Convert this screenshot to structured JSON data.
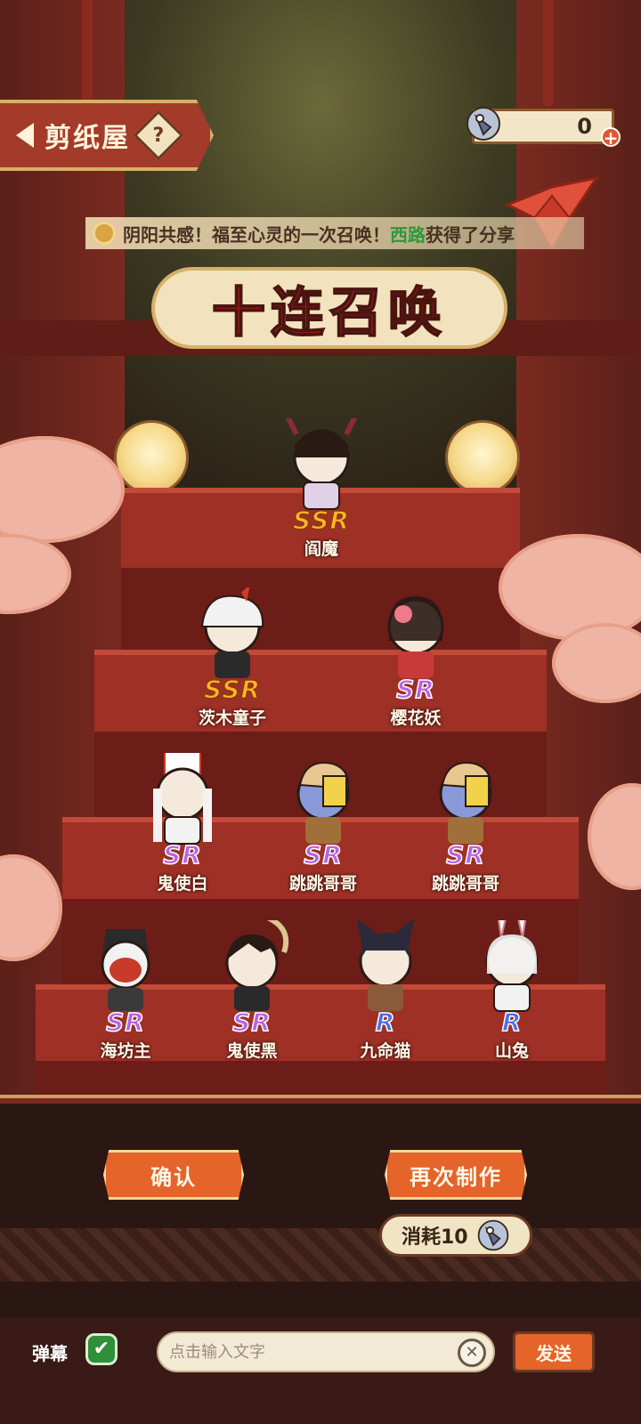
{
  "header": {
    "title": "剪纸屋",
    "help_symbol": "?",
    "currency_value": "0",
    "plus_symbol": "+"
  },
  "marquee": {
    "prefix": "阴阳共感！福至心灵的一次召唤！",
    "player": "西路",
    "suffix": "获得了分享"
  },
  "banner": {
    "title": "十连召唤"
  },
  "results": [
    {
      "rarity": "SSR",
      "name": "阎魔"
    },
    {
      "rarity": "SSR",
      "name": "茨木童子"
    },
    {
      "rarity": "SR",
      "name": "樱花妖"
    },
    {
      "rarity": "SR",
      "name": "鬼使白"
    },
    {
      "rarity": "SR",
      "name": "跳跳哥哥"
    },
    {
      "rarity": "SR",
      "name": "跳跳哥哥"
    },
    {
      "rarity": "SR",
      "name": "海坊主"
    },
    {
      "rarity": "SR",
      "name": "鬼使黑"
    },
    {
      "rarity": "R",
      "name": "九命猫"
    },
    {
      "rarity": "R",
      "name": "山兔"
    }
  ],
  "actions": {
    "confirm": "确认",
    "redo": "再次制作",
    "cost": "消耗10"
  },
  "chat": {
    "danmu_label": "弹幕",
    "check_symbol": "✔",
    "placeholder": "点击输入文字",
    "clear_symbol": "✕",
    "send": "发送"
  },
  "colors": {
    "accent": "#e4642a",
    "ssr": "#ffb526",
    "sr": "#b364e4",
    "r": "#4a6ee8"
  }
}
